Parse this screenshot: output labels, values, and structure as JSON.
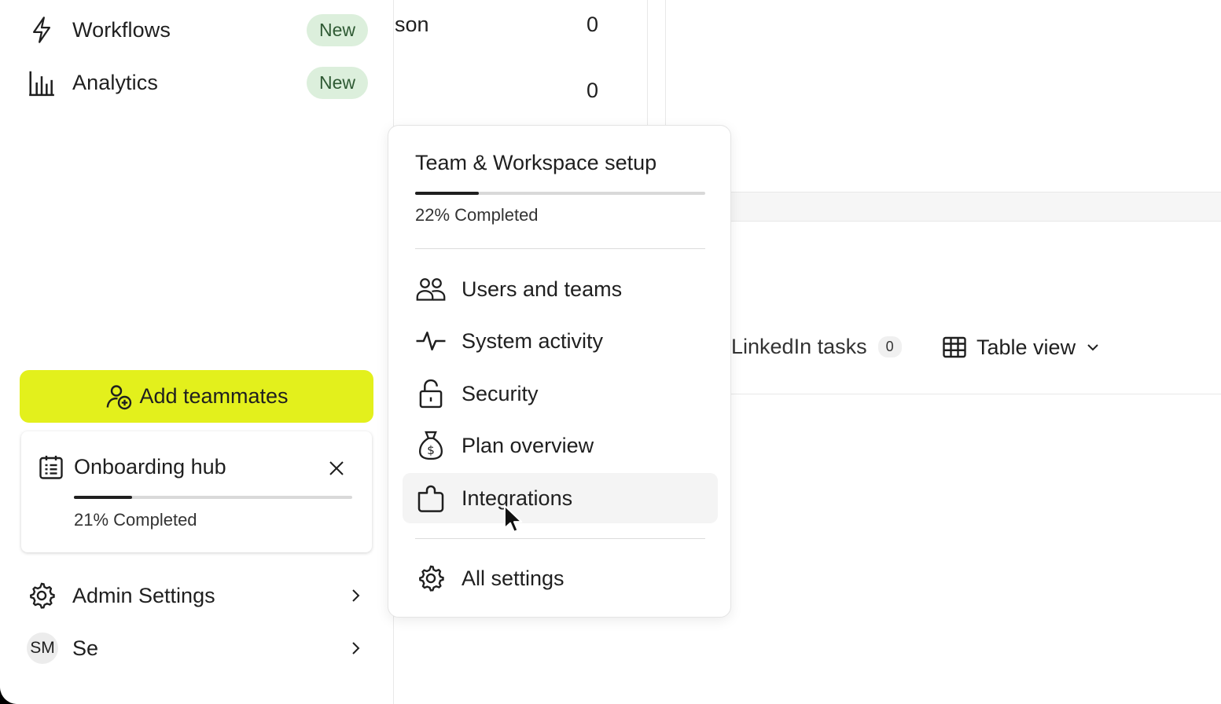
{
  "sidebar": {
    "nav": [
      {
        "label": "Workflows",
        "badge": "New",
        "icon": "bolt-icon"
      },
      {
        "label": "Analytics",
        "badge": "New",
        "icon": "bar-chart-icon"
      }
    ],
    "add_teammates": {
      "label": "Add teammates",
      "icon": "user-plus-icon",
      "color": "#e3f01c"
    },
    "onboarding_hub": {
      "title": "Onboarding hub",
      "progress_label": "21% Completed",
      "progress": 0.21,
      "icon": "calendar-checklist-icon"
    },
    "admin_settings": {
      "label": "Admin Settings",
      "icon": "gear-icon"
    },
    "user": {
      "initials": "SM",
      "label": "Se"
    }
  },
  "background": {
    "table_rows": [
      {
        "name": "son",
        "value": "0"
      },
      {
        "name": "",
        "value": "0"
      }
    ],
    "linkedin_tasks": {
      "label": "LinkedIn tasks",
      "count": "0"
    },
    "view_selector": {
      "label": "Table view",
      "icon": "table-icon"
    }
  },
  "popover": {
    "title": "Team & Workspace setup",
    "progress_label": "22% Completed",
    "progress": 0.22,
    "items": [
      {
        "label": "Users and teams",
        "icon": "users-icon"
      },
      {
        "label": "System activity",
        "icon": "activity-icon"
      },
      {
        "label": "Security",
        "icon": "lock-icon"
      },
      {
        "label": "Plan overview",
        "icon": "money-bag-icon"
      },
      {
        "label": "Integrations",
        "icon": "puzzle-icon",
        "hovered": true
      },
      {
        "label": "All settings",
        "icon": "gear-icon"
      }
    ]
  }
}
